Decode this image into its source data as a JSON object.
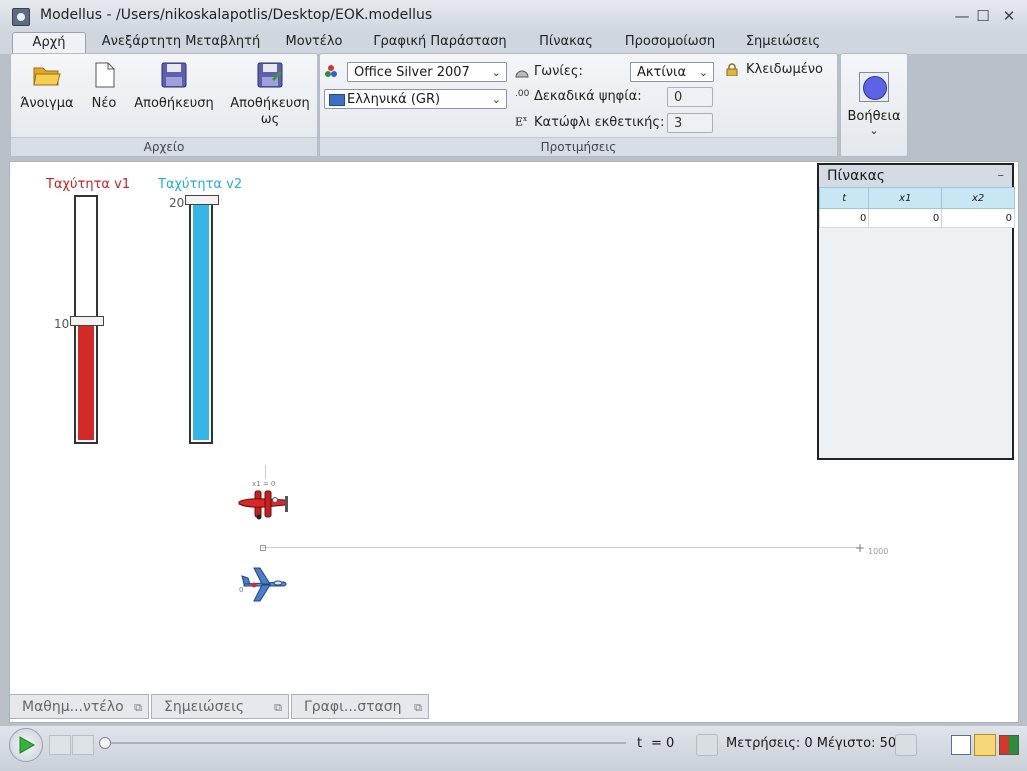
{
  "window": {
    "title": "Modellus - /Users/nikoskalapotlis/Desktop/EOK.modellus"
  },
  "menu_tabs": [
    {
      "label": "Αρχή"
    },
    {
      "label": "Ανεξάρτητη Μεταβλητή"
    },
    {
      "label": "Μοντέλο"
    },
    {
      "label": "Γραφική Παράσταση"
    },
    {
      "label": "Πίνακας"
    },
    {
      "label": "Προσομοίωση"
    },
    {
      "label": "Σημειώσεις"
    }
  ],
  "file_group": {
    "label": "Αρχείο",
    "buttons": [
      {
        "label": "Άνοιγμα",
        "icon": "folder-open-icon"
      },
      {
        "label": "Νέο",
        "icon": "new-document-icon"
      },
      {
        "label": "Αποθήκευση",
        "icon": "floppy-disk-icon"
      },
      {
        "label": "Αποθήκευση ως",
        "icon": "floppy-save-as-icon"
      }
    ]
  },
  "prefs_group": {
    "label": "Προτιμήσεις",
    "theme": "Office Silver 2007",
    "language": "Ελληνικά (GR)",
    "angles_label": "Γωνίες:",
    "angles_value": "Ακτίνια",
    "decimals_label": "Δεκαδικά ψηφία:",
    "decimals_value": "0",
    "exp_label": "Κατώφλι εκθετικής:",
    "exp_value": "3",
    "locked_label": "Κλειδωμένο"
  },
  "help_group": {
    "label": "Βοήθεια"
  },
  "sliders": [
    {
      "label": "Ταχύτητα v1",
      "value": 10,
      "max": 20,
      "color": "#d22b27",
      "label_color": "#cc2222"
    },
    {
      "label": "Ταχύτητα v2",
      "value": 20,
      "max": 20,
      "color": "#36b6e6",
      "label_color": "#2aa8d8"
    }
  ],
  "slider_ticks": {
    "v1": "10",
    "v2": "20"
  },
  "scene": {
    "x1_label": "x1 = 0",
    "axis_end": "1000",
    "plane2_label": "0"
  },
  "table": {
    "title": "Πίνακας",
    "columns": [
      "t",
      "x1",
      "x2"
    ],
    "rows": [
      [
        "0",
        "0",
        "0"
      ]
    ]
  },
  "bottom_tabs": [
    {
      "label": "Μαθημ...ντέλο"
    },
    {
      "label": "Σημειώσεις"
    },
    {
      "label": "Γραφι...σταση"
    }
  ],
  "status": {
    "t_label": "t",
    "t_value": "= 0",
    "measurements": "Μετρήσεις: 0 Μέγιστο: 50",
    "progress": 0
  }
}
